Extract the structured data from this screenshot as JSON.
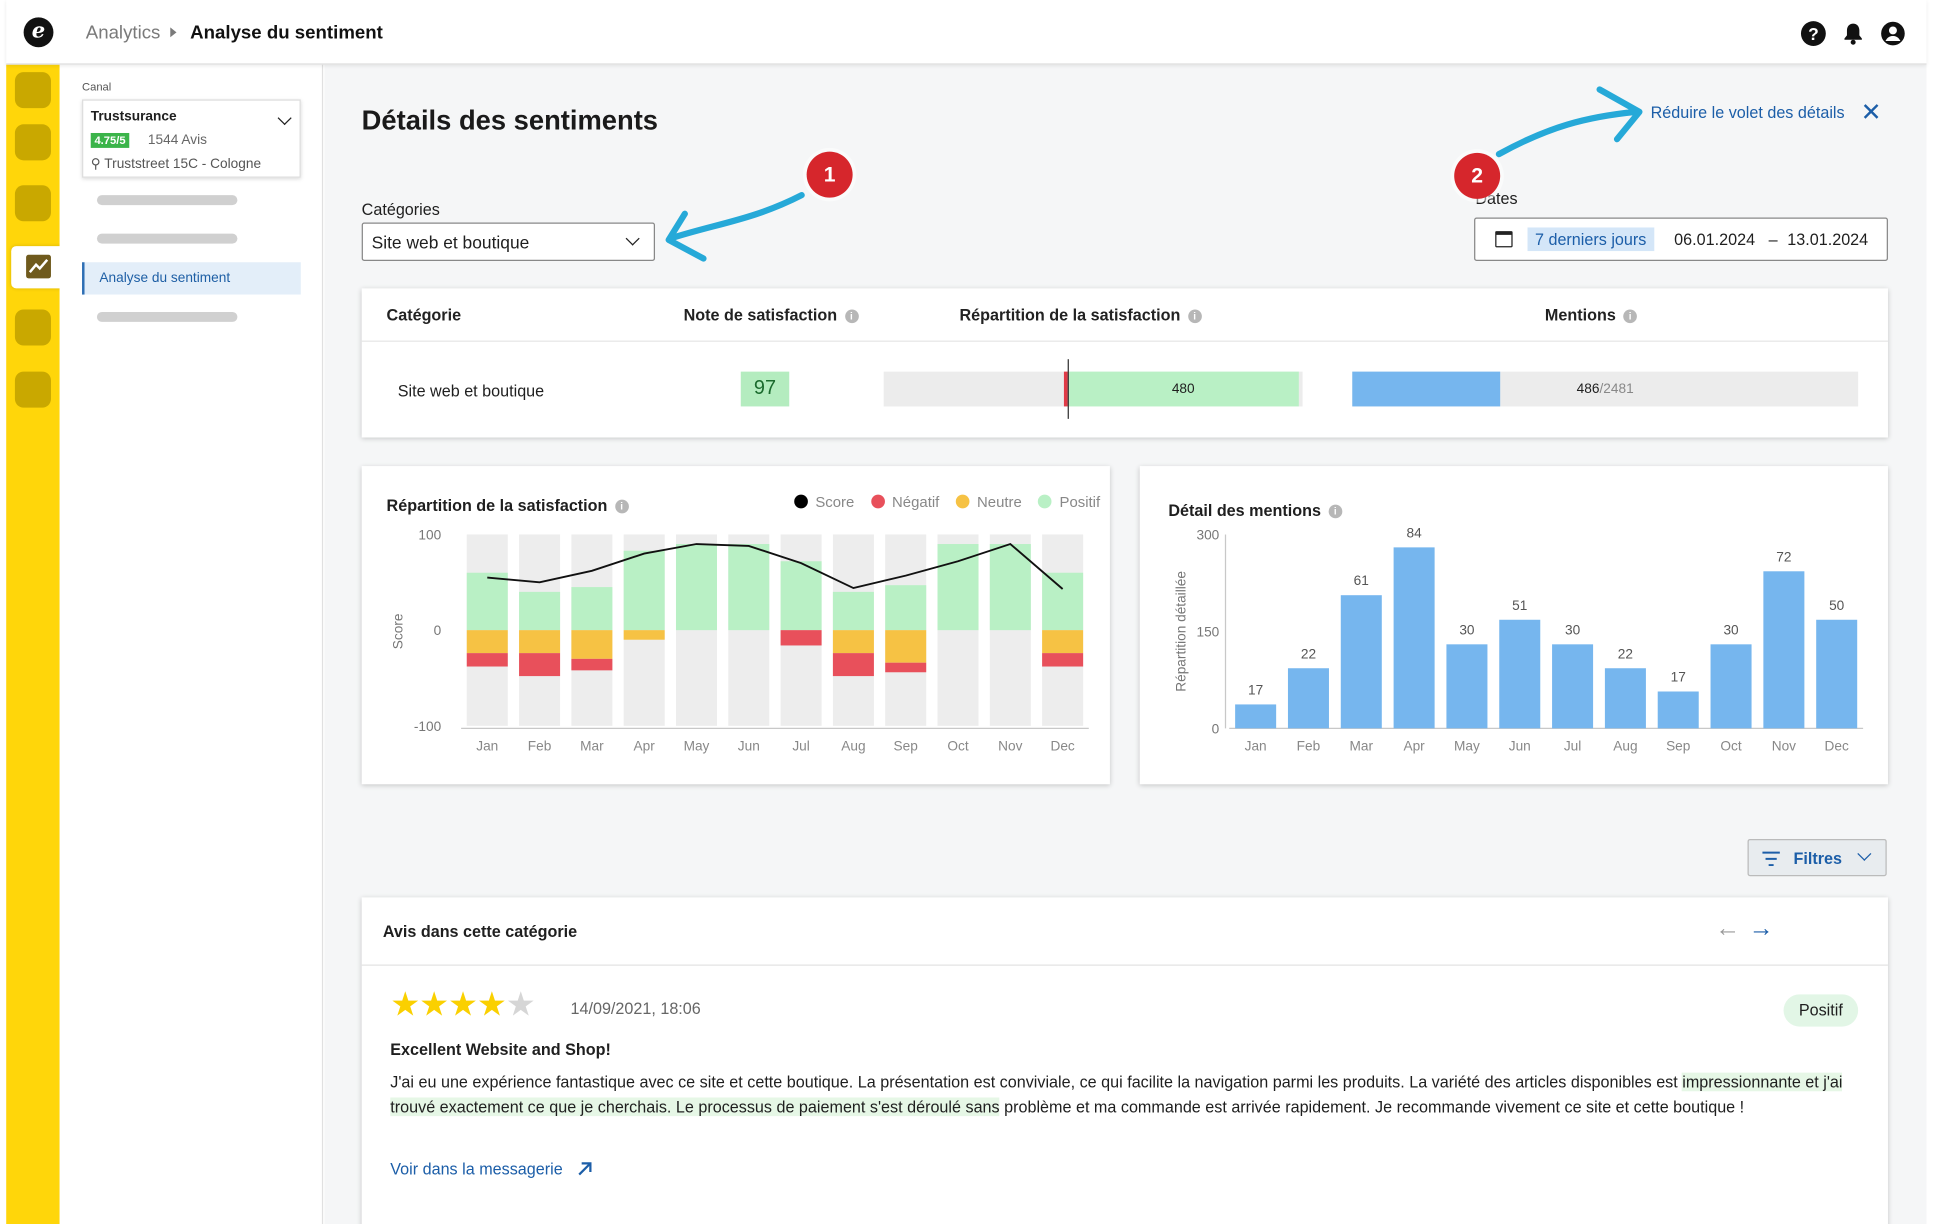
{
  "app": {
    "logo_letter": "e",
    "breadcrumb": {
      "parent": "Analytics",
      "current": "Analyse du sentiment"
    },
    "top_icons": [
      "help-icon",
      "bell-icon",
      "account-icon"
    ]
  },
  "colors": {
    "rail": "#ffd60a",
    "accent": "#1c5ea8",
    "positive": "#b9f0c5",
    "negative": "#e8505b",
    "neutral": "#f6c244",
    "mentions": "#76b6ee",
    "annotation": "#d6262c"
  },
  "sidebar": {
    "channel_label": "Canal",
    "channel": {
      "name": "Trustsurance",
      "rating": "4.75/5",
      "reviews": "1544 Avis",
      "address": "Truststreet 15C - Cologne"
    },
    "active_item": "Analyse du sentiment"
  },
  "page": {
    "title": "Détails des sentiments",
    "collapse_label": "Réduire le volet des détails",
    "categories_label": "Catégories",
    "category_value": "Site web et boutique",
    "dates_label": "Dates",
    "date_preset": "7 derniers jours",
    "date_from": "06.01.2024",
    "date_sep": "–",
    "date_to": "13.01.2024",
    "annotations": [
      "1",
      "2"
    ]
  },
  "table": {
    "headers": {
      "category": "Catégorie",
      "score": "Note de satisfaction",
      "distribution": "Répartition de la satisfaction",
      "mentions": "Mentions"
    },
    "row": {
      "category": "Site web et boutique",
      "score": "97",
      "positive_count": "480",
      "mentions": "486",
      "mentions_total": "/2481",
      "negative_fraction": 0.01,
      "mentions_fraction": 0.196
    }
  },
  "satisfaction_chart": {
    "title": "Répartition de la satisfaction",
    "legend": {
      "score": "Score",
      "negative": "Négatif",
      "neutral": "Neutre",
      "positive": "Positif"
    }
  },
  "mentions_chart": {
    "title": "Détail des mentions"
  },
  "chart_data": [
    {
      "type": "bar",
      "title": "Répartition de la satisfaction",
      "ylabel": "Score",
      "ylim": [
        -100,
        100
      ],
      "y_ticks": [
        100,
        0,
        -100
      ],
      "categories": [
        "Jan",
        "Feb",
        "Mar",
        "Apr",
        "May",
        "Jun",
        "Jul",
        "Aug",
        "Sep",
        "Oct",
        "Nov",
        "Dec"
      ],
      "series": [
        {
          "name": "Positif",
          "values": [
            60,
            40,
            45,
            83,
            90,
            90,
            72,
            40,
            47,
            90,
            90,
            60
          ]
        },
        {
          "name": "Neutre",
          "values": [
            -24,
            -24,
            -30,
            -10,
            0,
            0,
            0,
            -24,
            -34,
            0,
            0,
            -24
          ]
        },
        {
          "name": "Négatif",
          "values": [
            -14,
            -24,
            -12,
            0,
            0,
            0,
            -16,
            -24,
            -10,
            0,
            0,
            -14
          ]
        },
        {
          "name": "Score",
          "type": "line",
          "values": [
            55,
            50,
            62,
            80,
            90,
            88,
            70,
            44,
            57,
            72,
            90,
            43
          ]
        }
      ]
    },
    {
      "type": "bar",
      "title": "Détail des mentions",
      "ylabel": "Répartition détaillée",
      "ylim": [
        0,
        300
      ],
      "y_ticks": [
        300,
        150,
        0
      ],
      "categories": [
        "Jan",
        "Feb",
        "Mar",
        "Apr",
        "May",
        "Jun",
        "Jul",
        "Aug",
        "Sep",
        "Oct",
        "Nov",
        "Dec"
      ],
      "values": [
        17,
        22,
        61,
        84,
        30,
        51,
        30,
        22,
        17,
        30,
        72,
        50
      ],
      "series": [
        {
          "name": "",
          "values": [
            17,
            22,
            61,
            84,
            30,
            51,
            30,
            22,
            17,
            30,
            72,
            50
          ],
          "display": [
            17,
            22,
            61,
            84,
            30,
            51,
            30,
            22,
            17,
            30,
            72,
            50
          ]
        }
      ],
      "display_values": [
        17,
        22,
        61,
        84,
        30,
        51,
        30,
        22,
        17,
        30,
        72,
        50
      ],
      "bar_values": [
        37,
        93,
        206,
        280,
        130,
        168,
        130,
        93,
        57,
        130,
        243,
        168
      ]
    }
  ],
  "filters": {
    "label": "Filtres"
  },
  "reviews": {
    "title": "Avis dans cette catégorie",
    "prev_arrow": "←",
    "next_arrow": "→",
    "item": {
      "stars": 4,
      "max_stars": 5,
      "date": "14/09/2021, 18:06",
      "sentiment": "Positif",
      "title": "Excellent Website and Shop!",
      "body_start": "J'ai eu une expérience fantastique avec ce site et cette boutique. La présentation est conviviale, ce qui facilite la navigation parmi les produits. La variété des articles disponibles est ",
      "body_highlight": "impressionnante et j'ai trouvé exactement ce que je cherchais. Le processus de paiement s'est déroulé sans",
      "body_end": " problème et ma commande est arrivée rapidement. Je recommande vivement ce site et cette boutique !",
      "link": "Voir dans la messagerie"
    }
  }
}
